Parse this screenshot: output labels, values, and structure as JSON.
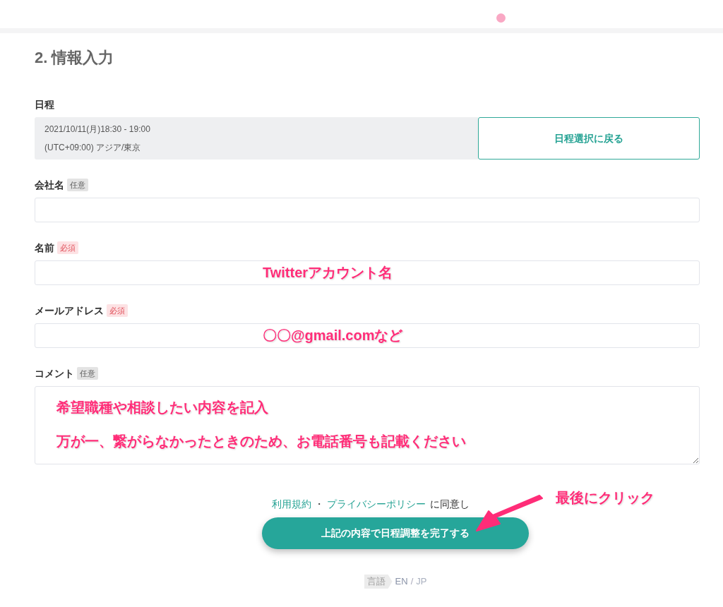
{
  "section_title": "2. 情報入力",
  "schedule": {
    "label": "日程",
    "datetime": "2021/10/11(月)18:30 - 19:00",
    "timezone": "(UTC+09:00) アジア/東京",
    "back_button": "日程選択に戻る"
  },
  "fields": [
    {
      "label": "会社名",
      "badge": "任意",
      "kind": "input",
      "required": false
    },
    {
      "label": "名前",
      "badge": "必須",
      "kind": "input",
      "required": true,
      "annotation": [
        "Twitterアカウント名"
      ]
    },
    {
      "label": "メールアドレス",
      "badge": "必須",
      "kind": "input",
      "required": true,
      "annotation": [
        "〇〇@gmail.comなど"
      ]
    },
    {
      "label": "コメント",
      "badge": "任意",
      "kind": "textarea",
      "required": false,
      "annotation": [
        "希望職種や相談したい内容を記入",
        "万が一、繋がらなかったときのため、お電話番号も記載ください"
      ]
    }
  ],
  "consent": {
    "terms_link": "利用規約",
    "separator": "・",
    "privacy_link": "プライバシーポリシー",
    "suffix": "に同意し"
  },
  "submit_button": "上記の内容で日程調整を完了する",
  "callout": "最後にクリック",
  "language": {
    "label": "言語",
    "options": [
      {
        "label": "EN",
        "selected": false
      },
      {
        "label": "JP",
        "selected": true
      }
    ],
    "separator": "/"
  }
}
